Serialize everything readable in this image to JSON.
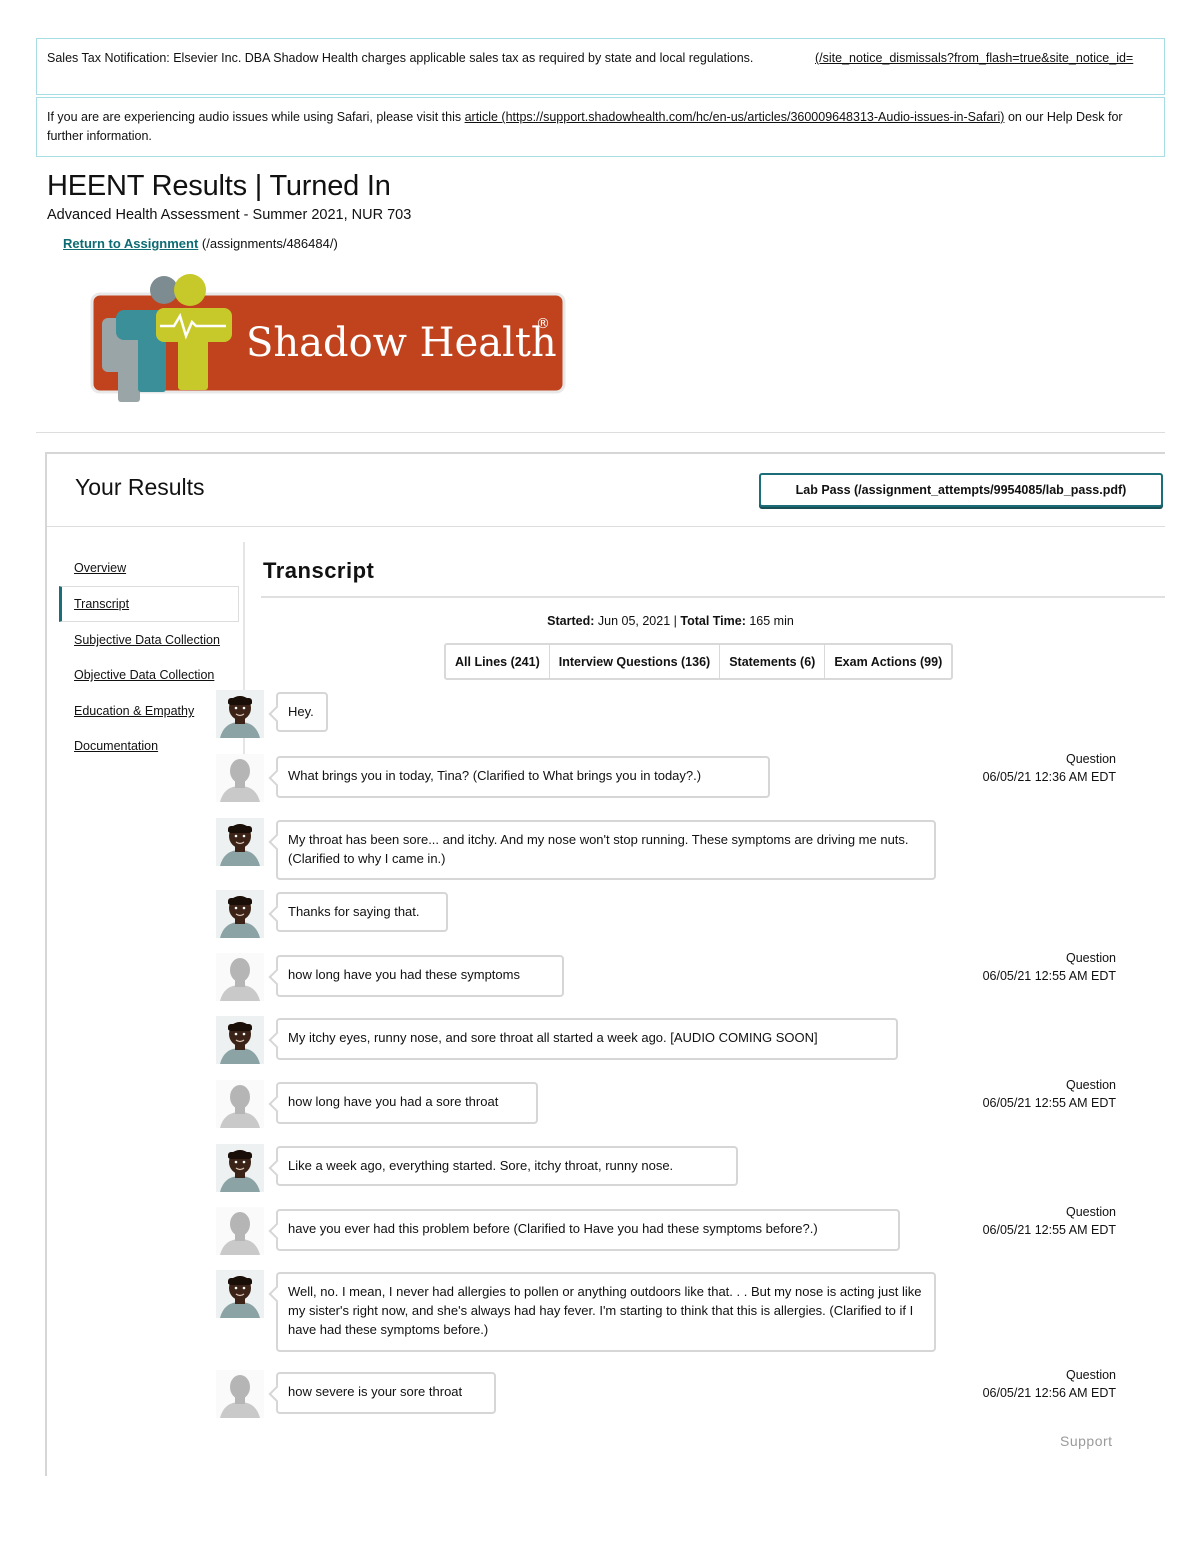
{
  "notices": {
    "sales_tax": "Sales Tax Notification: Elsevier Inc. DBA Shadow Health charges applicable sales tax as required by state and local regulations.",
    "dismiss_link": "(/site_notice_dismissals?from_flash=true&site_notice_id=",
    "audio_prefix": "If you are are experiencing audio issues while using Safari, please visit this ",
    "audio_link": "article (https://support.shadowhealth.com/hc/en-us/articles/360009648313-Audio-issues-in-Safari)",
    "audio_suffix": " on our Help Desk for further information."
  },
  "header": {
    "title": "HEENT Results | Turned In",
    "subtitle": "Advanced Health Assessment - Summer 2021, NUR 703",
    "return_label": "Return to Assignment",
    "return_path": " (/assignments/486484/)"
  },
  "logo": {
    "text": "Shadow Health",
    "mark": "®",
    "name": "shadow-health-logo"
  },
  "results": {
    "title": "Your Results",
    "lab_pass": "Lab Pass (/assignment_attempts/9954085/lab_pass.pdf)"
  },
  "sidebar": {
    "items": [
      {
        "label": "Overview"
      },
      {
        "label": "Transcript"
      },
      {
        "label": "Subjective Data Collection"
      },
      {
        "label": "Objective Data Collection"
      },
      {
        "label": "Education & Empathy"
      },
      {
        "label": "Documentation"
      }
    ],
    "active": "Transcript"
  },
  "transcript": {
    "title": "Transcript",
    "started_label": "Started:",
    "started_value": " Jun 05, 2021 | ",
    "total_label": "Total Time:",
    "total_value": " 165 min",
    "filters": [
      "All Lines (241)",
      "Interview Questions (136)",
      "Statements (6)",
      "Exam Actions (99)"
    ],
    "messages": [
      {
        "speaker": "patient",
        "text": "Hey."
      },
      {
        "speaker": "student",
        "text": "What brings you in today, Tina? (Clarified to What brings you in today?.)",
        "kind": "Question",
        "time": "06/05/21 12:36 AM EDT"
      },
      {
        "speaker": "patient",
        "text": "My throat has been sore... and itchy. And my nose won't stop running. These symptoms are driving me nuts. (Clarified to why I came in.)"
      },
      {
        "speaker": "patient",
        "text": "Thanks for saying that."
      },
      {
        "speaker": "student",
        "text": "how long have you had these symptoms",
        "kind": "Question",
        "time": "06/05/21 12:55 AM EDT"
      },
      {
        "speaker": "patient",
        "text": "My itchy eyes, runny nose, and sore throat all started a week ago. [AUDIO COMING SOON]"
      },
      {
        "speaker": "student",
        "text": "how long have you had a sore throat",
        "kind": "Question",
        "time": "06/05/21 12:55 AM EDT"
      },
      {
        "speaker": "patient",
        "text": "Like a week ago, everything started. Sore, itchy throat, runny nose."
      },
      {
        "speaker": "student",
        "text": "have you ever had this problem before (Clarified to Have you had these symptoms before?.)",
        "kind": "Question",
        "time": "06/05/21 12:55 AM EDT"
      },
      {
        "speaker": "patient",
        "text": "Well, no. I mean, I never had allergies to pollen or anything outdoors like that. . . But my nose is acting just like my sister's right now, and she's always had hay fever. I'm starting to think that this is allergies. (Clarified to if I have had these symptoms before.)"
      },
      {
        "speaker": "student",
        "text": "how severe is your sore throat",
        "kind": "Question",
        "time": "06/05/21 12:56 AM EDT"
      }
    ]
  },
  "footer": {
    "support": "Support"
  }
}
